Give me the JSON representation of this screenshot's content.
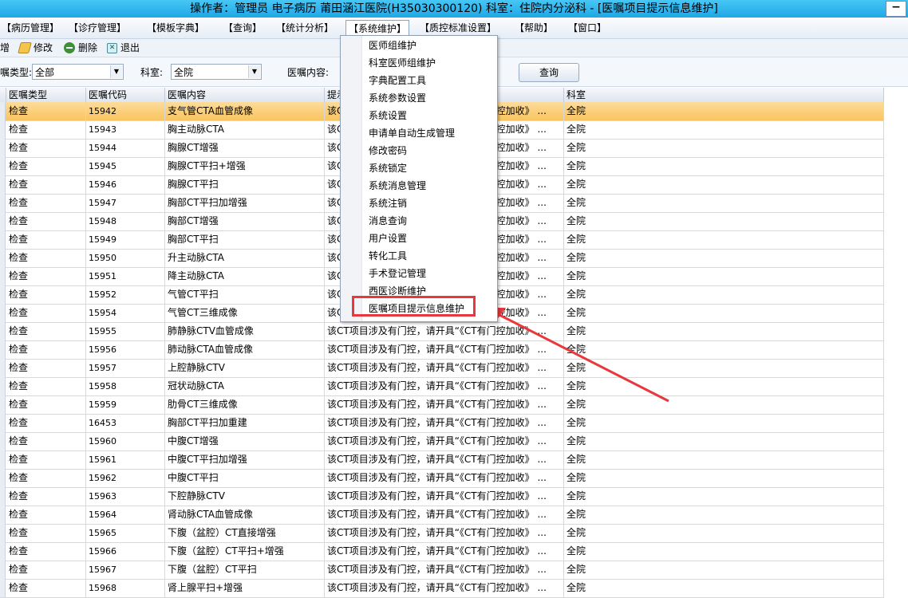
{
  "window": {
    "title": "操作者：管理员 电子病历  莆田涵江医院(H35030300120)  科室：住院内分泌科 - [医嘱项目提示信息维护]",
    "minimize_label": "−"
  },
  "menubar": {
    "items": [
      "【病历管理】",
      "【诊疗管理】",
      "【模板字典】",
      "【查询】",
      "【统计分析】",
      "【系统维护】",
      "【质控标准设置】",
      "【帮助】",
      "【窗口】"
    ],
    "active": "【系统维护】"
  },
  "toolbar": {
    "new_label": "增",
    "edit_label": "修改",
    "delete_label": "删除",
    "exit_label": "退出"
  },
  "filter": {
    "type_label": "嘱类型:",
    "type_value": "全部",
    "dept_label": "科室:",
    "dept_value": "全院",
    "content_label": "医嘱内容:",
    "query_button": "查询"
  },
  "grid": {
    "columns": [
      "医嘱类型",
      "医嘱代码",
      "医嘱内容",
      "提示",
      "科室"
    ],
    "rows": [
      [
        "检查",
        "15942",
        "支气管CTA血管成像",
        "该CT项目涉及有门控，请开具“《CT有门控加收》 ...",
        "全院"
      ],
      [
        "检查",
        "15943",
        "胸主动脉CTA",
        "该CT项目涉及有门控，请开具“《CT有门控加收》 ...",
        "全院"
      ],
      [
        "检查",
        "15944",
        "胸腺CT增强",
        "该CT项目涉及有门控，请开具“《CT有门控加收》 ...",
        "全院"
      ],
      [
        "检查",
        "15945",
        "胸腺CT平扫+增强",
        "该CT项目涉及有门控，请开具“《CT有门控加收》 ...",
        "全院"
      ],
      [
        "检查",
        "15946",
        "胸腺CT平扫",
        "该CT项目涉及有门控，请开具“《CT有门控加收》 ...",
        "全院"
      ],
      [
        "检查",
        "15947",
        "胸部CT平扫加增强",
        "该CT项目涉及有门控，请开具“《CT有门控加收》 ...",
        "全院"
      ],
      [
        "检查",
        "15948",
        "胸部CT增强",
        "该CT项目涉及有门控，请开具“《CT有门控加收》 ...",
        "全院"
      ],
      [
        "检查",
        "15949",
        "胸部CT平扫",
        "该CT项目涉及有门控，请开具“《CT有门控加收》 ...",
        "全院"
      ],
      [
        "检查",
        "15950",
        "升主动脉CTA",
        "该CT项目涉及有门控，请开具“《CT有门控加收》 ...",
        "全院"
      ],
      [
        "检查",
        "15951",
        "降主动脉CTA",
        "该CT项目涉及有门控，请开具“《CT有门控加收》 ...",
        "全院"
      ],
      [
        "检查",
        "15952",
        "气管CT平扫",
        "该CT项目涉及有门控，请开具“《CT有门控加收》 ...",
        "全院"
      ],
      [
        "检查",
        "15954",
        "气管CT三维成像",
        "该CT项目涉及有门控，请开具“《CT有门控加收》 ...",
        "全院"
      ],
      [
        "检查",
        "15955",
        "肺静脉CTV血管成像",
        "该CT项目涉及有门控，请开具“《CT有门控加收》 ...",
        "全院"
      ],
      [
        "检查",
        "15956",
        "肺动脉CTA血管成像",
        "该CT项目涉及有门控，请开具“《CT有门控加收》 ...",
        "全院"
      ],
      [
        "检查",
        "15957",
        "上腔静脉CTV",
        "该CT项目涉及有门控，请开具“《CT有门控加收》 ...",
        "全院"
      ],
      [
        "检查",
        "15958",
        "冠状动脉CTA",
        "该CT项目涉及有门控，请开具“《CT有门控加收》 ...",
        "全院"
      ],
      [
        "检查",
        "15959",
        "肋骨CT三维成像",
        "该CT项目涉及有门控，请开具“《CT有门控加收》 ...",
        "全院"
      ],
      [
        "检查",
        "16453",
        "胸部CT平扫加重建",
        "该CT项目涉及有门控，请开具“《CT有门控加收》 ...",
        "全院"
      ],
      [
        "检查",
        "15960",
        "中腹CT增强",
        "该CT项目涉及有门控，请开具“《CT有门控加收》 ...",
        "全院"
      ],
      [
        "检查",
        "15961",
        "中腹CT平扫加增强",
        "该CT项目涉及有门控，请开具“《CT有门控加收》 ...",
        "全院"
      ],
      [
        "检查",
        "15962",
        "中腹CT平扫",
        "该CT项目涉及有门控，请开具“《CT有门控加收》 ...",
        "全院"
      ],
      [
        "检查",
        "15963",
        "下腔静脉CTV",
        "该CT项目涉及有门控，请开具“《CT有门控加收》 ...",
        "全院"
      ],
      [
        "检查",
        "15964",
        "肾动脉CTA血管成像",
        "该CT项目涉及有门控，请开具“《CT有门控加收》 ...",
        "全院"
      ],
      [
        "检查",
        "15965",
        "下腹（盆腔）CT直接增强",
        "该CT项目涉及有门控，请开具“《CT有门控加收》 ...",
        "全院"
      ],
      [
        "检查",
        "15966",
        "下腹（盆腔）CT平扫+增强",
        "该CT项目涉及有门控，请开具“《CT有门控加收》 ...",
        "全院"
      ],
      [
        "检查",
        "15967",
        "下腹（盆腔）CT平扫",
        "该CT项目涉及有门控，请开具“《CT有门控加收》 ...",
        "全院"
      ],
      [
        "检查",
        "15968",
        "肾上腺平扫+增强",
        "该CT项目涉及有门控，请开具“《CT有门控加收》 ...",
        "全院"
      ]
    ]
  },
  "dropdown": {
    "items": [
      "医师组维护",
      "科室医师组维护",
      "字典配置工具",
      "系统参数设置",
      "系统设置",
      "申请单自动生成管理",
      "修改密码",
      "系统锁定",
      "系统消息管理",
      "系统注销",
      "消息查询",
      "用户设置",
      "转化工具",
      "手术登记管理",
      "西医诊断维护",
      "医嘱项目提示信息维护"
    ],
    "highlighted": "医嘱项目提示信息维护"
  },
  "colors": {
    "title_bar": "#1fa7e6",
    "selected_row": "#f9c55e",
    "annotation_red": "#e8383d"
  }
}
